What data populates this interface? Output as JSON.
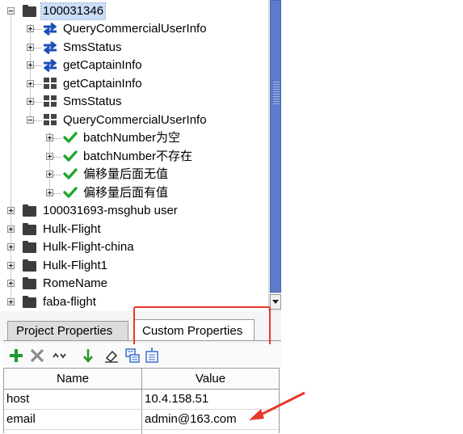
{
  "tree": {
    "nodes": [
      {
        "label": "100031346",
        "icon": "folder-icon",
        "expander": "minus",
        "selected": true
      },
      {
        "label": "QueryCommercialUserInfo",
        "icon": "swap-arrows-icon",
        "expander": "plus"
      },
      {
        "label": "SmsStatus",
        "icon": "swap-arrows-icon",
        "expander": "plus"
      },
      {
        "label": "getCaptainInfo",
        "icon": "swap-arrows-icon",
        "expander": "plus"
      },
      {
        "label": "getCaptainInfo",
        "icon": "grid-icon",
        "expander": "plus"
      },
      {
        "label": "SmsStatus",
        "icon": "grid-icon",
        "expander": "plus"
      },
      {
        "label": "QueryCommercialUserInfo",
        "icon": "grid-icon",
        "expander": "minus"
      },
      {
        "label": "batchNumber为空",
        "icon": "checkmark-icon",
        "expander": "plus"
      },
      {
        "label": "batchNumber不存在",
        "icon": "checkmark-icon",
        "expander": "plus"
      },
      {
        "label": "偏移量后面无值",
        "icon": "checkmark-icon",
        "expander": "plus"
      },
      {
        "label": "偏移量后面有值",
        "icon": "checkmark-icon",
        "expander": "plus"
      },
      {
        "label": "100031693-msghub user",
        "icon": "folder-icon",
        "expander": "plus"
      },
      {
        "label": "Hulk-Flight",
        "icon": "folder-icon",
        "expander": "plus"
      },
      {
        "label": "Hulk-Flight-china",
        "icon": "folder-icon",
        "expander": "plus"
      },
      {
        "label": "Hulk-Flight1",
        "icon": "folder-icon",
        "expander": "plus"
      },
      {
        "label": "RomeName",
        "icon": "folder-icon",
        "expander": "plus"
      },
      {
        "label": "faba-flight",
        "icon": "folder-icon",
        "expander": "plus"
      }
    ]
  },
  "tabs": {
    "project": "Project Properties",
    "custom": "Custom Properties",
    "active": "custom"
  },
  "toolbar": {
    "icons": [
      "add-icon",
      "delete-icon",
      "move-up-down-icon",
      "move-down-icon",
      "clear-icon",
      "load-properties-icon",
      "save-properties-icon"
    ]
  },
  "properties": {
    "headers": {
      "name": "Name",
      "value": "Value"
    },
    "rows": [
      {
        "name": "host",
        "value": "10.4.158.51"
      },
      {
        "name": "email",
        "value": "admin@163.com"
      }
    ]
  },
  "colors": {
    "selection": "#c9ddf7",
    "scrollbar_thumb": "#5c7bc8",
    "swap_icon": "#1b4fb8",
    "check_icon": "#21a82f",
    "annotation": "#e8372c"
  }
}
